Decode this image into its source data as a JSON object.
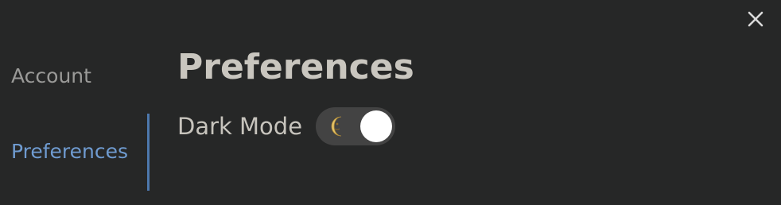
{
  "dialog": {
    "close_icon": "close-icon",
    "accent_color": "#6f9bd0"
  },
  "sidebar": {
    "items": [
      {
        "label": "Account",
        "active": false
      },
      {
        "label": "Preferences",
        "active": true
      }
    ]
  },
  "main": {
    "title": "Preferences",
    "settings": [
      {
        "label": "Dark Mode",
        "control": "toggle",
        "value": true,
        "icon": "moon-icon"
      }
    ]
  }
}
